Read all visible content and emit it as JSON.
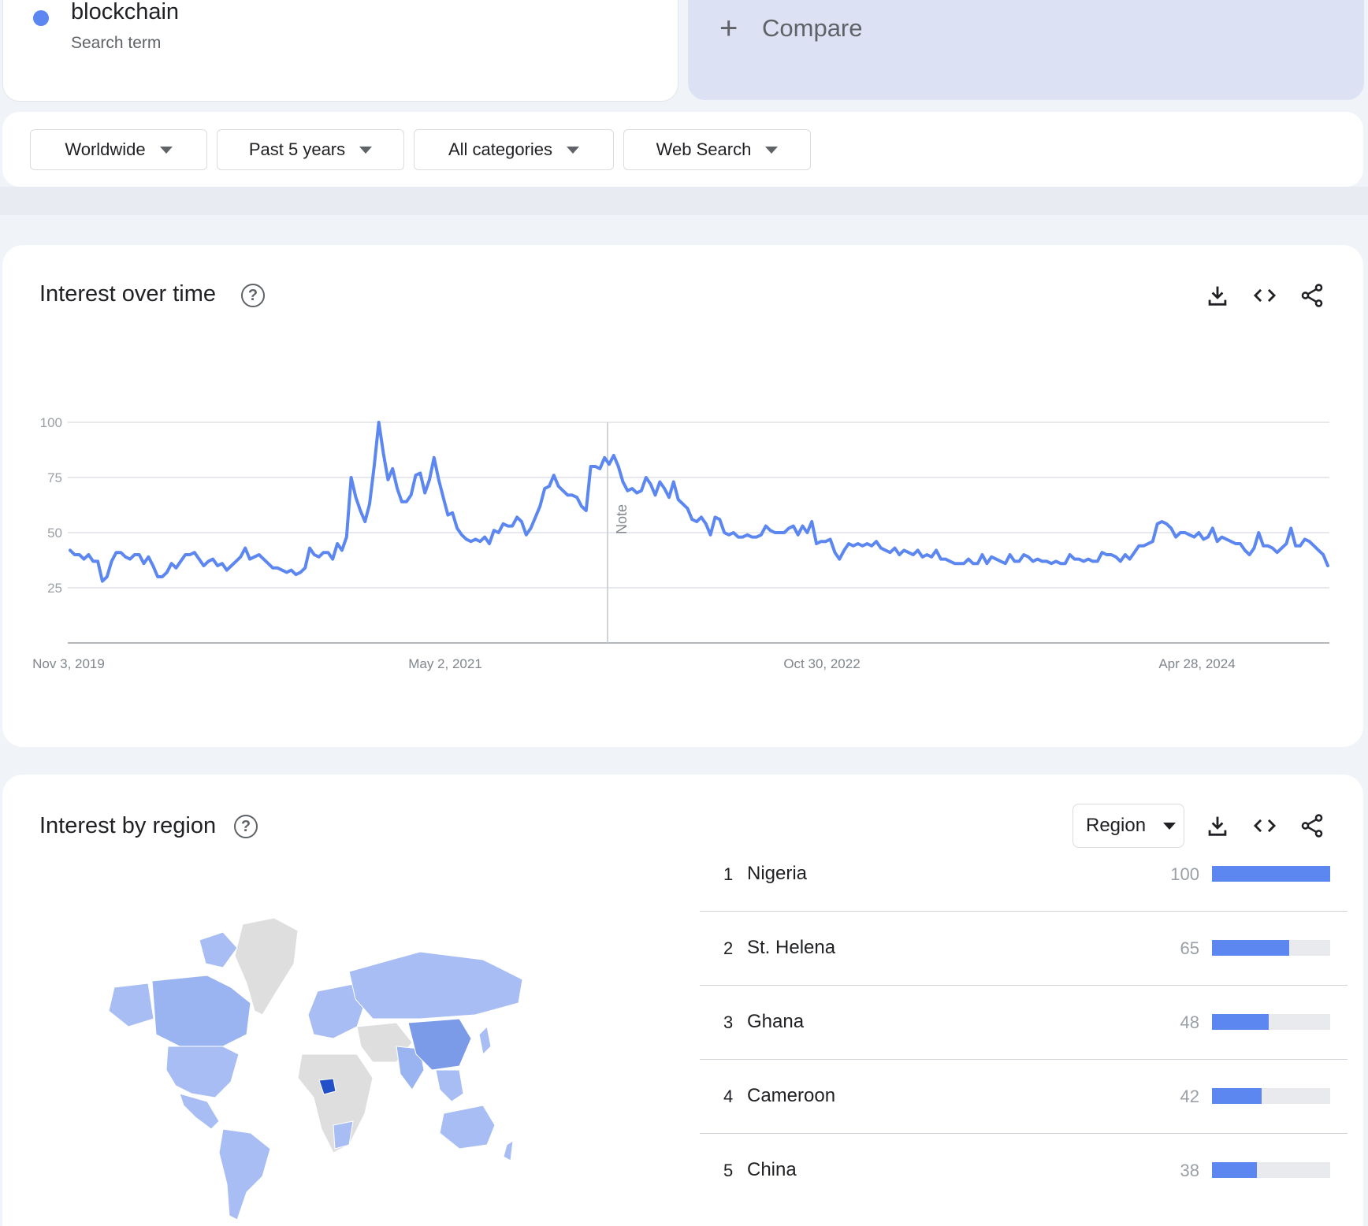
{
  "search_term": {
    "name": "blockchain",
    "subtitle": "Search term",
    "color": "#5c87f0"
  },
  "compare": {
    "label": "Compare",
    "icon": "plus-icon"
  },
  "filters": [
    {
      "label": "Worldwide"
    },
    {
      "label": "Past 5 years"
    },
    {
      "label": "All categories"
    },
    {
      "label": "Web Search"
    }
  ],
  "interest_over_time": {
    "title": "Interest over time",
    "note_label": "Note",
    "tools": [
      "download-icon",
      "embed-code-icon",
      "share-icon"
    ]
  },
  "chart_data": {
    "type": "line",
    "x_labels": [
      "Nov 3, 2019",
      "May 2, 2021",
      "Oct 30, 2022",
      "Apr 28, 2024"
    ],
    "y_ticks": [
      25,
      50,
      75,
      100
    ],
    "ylim": [
      0,
      100
    ],
    "grid": true,
    "series": [
      {
        "color": "#5c87f0",
        "values": [
          42,
          40,
          40,
          38,
          40,
          37,
          37,
          28,
          30,
          37,
          41,
          41,
          39,
          38,
          40,
          40,
          36,
          39,
          35,
          30,
          30,
          32,
          36,
          34,
          37,
          40,
          40,
          41,
          38,
          35,
          37,
          38,
          35,
          36,
          33,
          35,
          37,
          39,
          43,
          38,
          39,
          40,
          38,
          36,
          34,
          34,
          33,
          32,
          33,
          31,
          32,
          34,
          43,
          40,
          39,
          41,
          41,
          38,
          45,
          42,
          48,
          75,
          66,
          60,
          55,
          63,
          80,
          100,
          86,
          74,
          79,
          70,
          64,
          64,
          67,
          76,
          77,
          68,
          74,
          84,
          74,
          66,
          58,
          59,
          52,
          49,
          47,
          46,
          47,
          46,
          48,
          45,
          51,
          50,
          54,
          53,
          53,
          57,
          55,
          49,
          52,
          57,
          62,
          70,
          71,
          76,
          71,
          69,
          67,
          67,
          66,
          62,
          60,
          80,
          80,
          79,
          84,
          81,
          85,
          80,
          73,
          69,
          70,
          68,
          69,
          75,
          72,
          67,
          73,
          70,
          66,
          73,
          65,
          63,
          61,
          56,
          55,
          57,
          54,
          49,
          57,
          56,
          50,
          49,
          50,
          48,
          48,
          49,
          48,
          48,
          49,
          53,
          51,
          50,
          50,
          50,
          52,
          53,
          49,
          53,
          50,
          55,
          45,
          46,
          46,
          47,
          41,
          38,
          42,
          45,
          44,
          45,
          44,
          45,
          44,
          46,
          43,
          42,
          41,
          43,
          40,
          42,
          41,
          40,
          42,
          39,
          40,
          39,
          42,
          38,
          38,
          37,
          36,
          36,
          36,
          38,
          36,
          36,
          40,
          36,
          39,
          38,
          37,
          36,
          40,
          37,
          37,
          40,
          39,
          37,
          38,
          37,
          37,
          36,
          37,
          36,
          36,
          40,
          38,
          38,
          37,
          38,
          37,
          37,
          41,
          40,
          40,
          39,
          37,
          40,
          38,
          41,
          44,
          44,
          45,
          46,
          54,
          55,
          54,
          52,
          48,
          50,
          50,
          49,
          48,
          50,
          47,
          48,
          52,
          46,
          48,
          47,
          46,
          45,
          45,
          42,
          40,
          43,
          50,
          44,
          44,
          43,
          41,
          43,
          45,
          52,
          44,
          44,
          47,
          46,
          44,
          42,
          40,
          35
        ]
      }
    ]
  },
  "interest_by_region": {
    "title": "Interest by region",
    "select_label": "Region",
    "tools": [
      "download-icon",
      "embed-code-icon",
      "share-icon"
    ],
    "rankings": [
      {
        "rank": "1",
        "name": "Nigeria",
        "value": "100",
        "fraction": 1.0
      },
      {
        "rank": "2",
        "name": "St. Helena",
        "value": "65",
        "fraction": 0.65
      },
      {
        "rank": "3",
        "name": "Ghana",
        "value": "48",
        "fraction": 0.48
      },
      {
        "rank": "4",
        "name": "Cameroon",
        "value": "42",
        "fraction": 0.42
      },
      {
        "rank": "5",
        "name": "China",
        "value": "38",
        "fraction": 0.38
      }
    ],
    "map_colors": {
      "high": "#2350c9",
      "medium": "#7b9ae8",
      "low": "#a7bdf3",
      "none": "#dedede"
    }
  }
}
